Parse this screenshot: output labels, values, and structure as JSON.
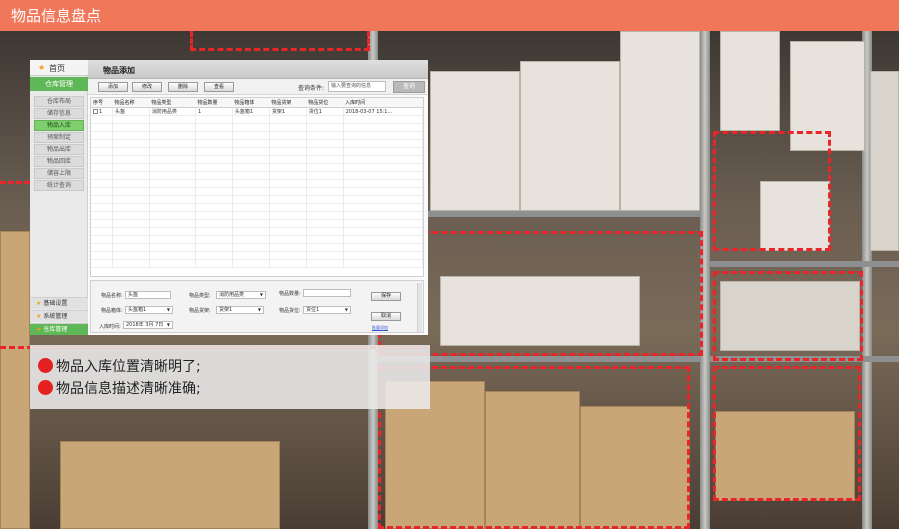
{
  "page": {
    "title": "物品信息盘点",
    "accent": "#f0775a"
  },
  "app": {
    "home_label": "首页",
    "warehouse_label": "仓库管理",
    "sidebar_items": [
      {
        "label": "仓库布局",
        "active": false
      },
      {
        "label": "储存信息",
        "active": false
      },
      {
        "label": "物品入库",
        "active": true
      },
      {
        "label": "预案制定",
        "active": false
      },
      {
        "label": "物品出库",
        "active": false
      },
      {
        "label": "物品回库",
        "active": false
      },
      {
        "label": "储容上限",
        "active": false
      },
      {
        "label": "统计查询",
        "active": false
      }
    ],
    "sidebar_bottom": [
      {
        "label": "基础设置"
      },
      {
        "label": "系统管理"
      },
      {
        "label": "仓库管理"
      }
    ],
    "main_title": "物品添加",
    "toolbar": {
      "buttons": [
        "添加",
        "修改",
        "删除",
        "查看"
      ],
      "query_label": "查询条件:",
      "query_placeholder": "输入要查询的信息",
      "query_button": "查询"
    },
    "table": {
      "columns": [
        "序号",
        "物品名称",
        "物品类型",
        "物品数量",
        "物品箱体",
        "物品货架",
        "物品货位",
        "入库时间"
      ],
      "rows": [
        [
          "1",
          "头盔",
          "消防用品类",
          "1",
          "头盔箱1",
          "货架1",
          "货位1",
          "2018-03-07 15:1..."
        ]
      ]
    },
    "form": {
      "name_label": "物品名称:",
      "name_value": "头盔",
      "type_label": "物品类型:",
      "type_value": "消防用品类",
      "qty_label": "物品数量:",
      "qty_value": "",
      "box_label": "物品箱体:",
      "box_value": "头盔箱1",
      "shelf_label": "物品货架:",
      "shelf_value": "货架1",
      "slot_label": "物品货位:",
      "slot_value": "货位1",
      "time_label": "入库时间:",
      "time_value": "2018年 3月 7日",
      "save_button": "保存",
      "cancel_button": "取消",
      "link": "批量添加"
    }
  },
  "notes": [
    "物品入库位置清晰明了;",
    "物品信息描述清晰准确;"
  ]
}
